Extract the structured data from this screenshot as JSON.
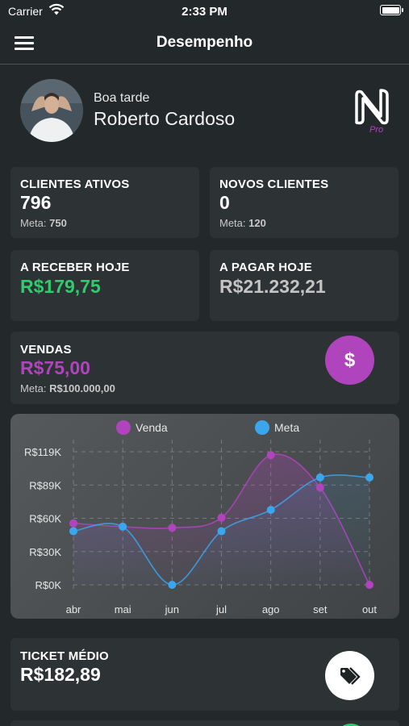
{
  "status_bar": {
    "carrier": "Carrier",
    "time": "2:33 PM"
  },
  "nav": {
    "title": "Desempenho"
  },
  "profile": {
    "greeting": "Boa tarde",
    "name": "Roberto Cardoso"
  },
  "cards": {
    "clientes_ativos": {
      "label": "CLIENTES ATIVOS",
      "value": "796",
      "meta_label": "Meta:",
      "meta_value": "750"
    },
    "novos_clientes": {
      "label": "NOVOS CLIENTES",
      "value": "0",
      "meta_label": "Meta:",
      "meta_value": "120"
    },
    "a_receber": {
      "label": "A RECEBER HOJE",
      "value": "R$179,75"
    },
    "a_pagar": {
      "label": "A PAGAR HOJE",
      "value": "R$21.232,21"
    },
    "vendas": {
      "label": "VENDAS",
      "value": "R$75,00",
      "meta_label": "Meta:",
      "meta_value": "R$100.000,00",
      "button_icon": "dollar-icon"
    },
    "ticket_medio": {
      "label": "TICKET MÉDIO",
      "value": "R$182,89",
      "button_icon": "tag-icon"
    }
  },
  "colors": {
    "venda": "#b044bd",
    "meta": "#3aa6ee",
    "receber": "#2ecc6e",
    "pagar": "#c4c4c4"
  },
  "chart_data": {
    "type": "line",
    "categories": [
      "abr",
      "mai",
      "jun",
      "jul",
      "ago",
      "set",
      "out"
    ],
    "y_ticks": [
      "R$0K",
      "R$30K",
      "R$60K",
      "R$89K",
      "R$119K"
    ],
    "ylim": [
      0,
      119000
    ],
    "grid": true,
    "legend_position": "top",
    "series": [
      {
        "name": "Venda",
        "color": "#b044bd",
        "values": [
          55000,
          52000,
          51000,
          60000,
          116000,
          87000,
          0
        ]
      },
      {
        "name": "Meta",
        "color": "#3aa6ee",
        "values": [
          48000,
          52000,
          0,
          48000,
          67000,
          96000,
          96000
        ]
      }
    ]
  }
}
